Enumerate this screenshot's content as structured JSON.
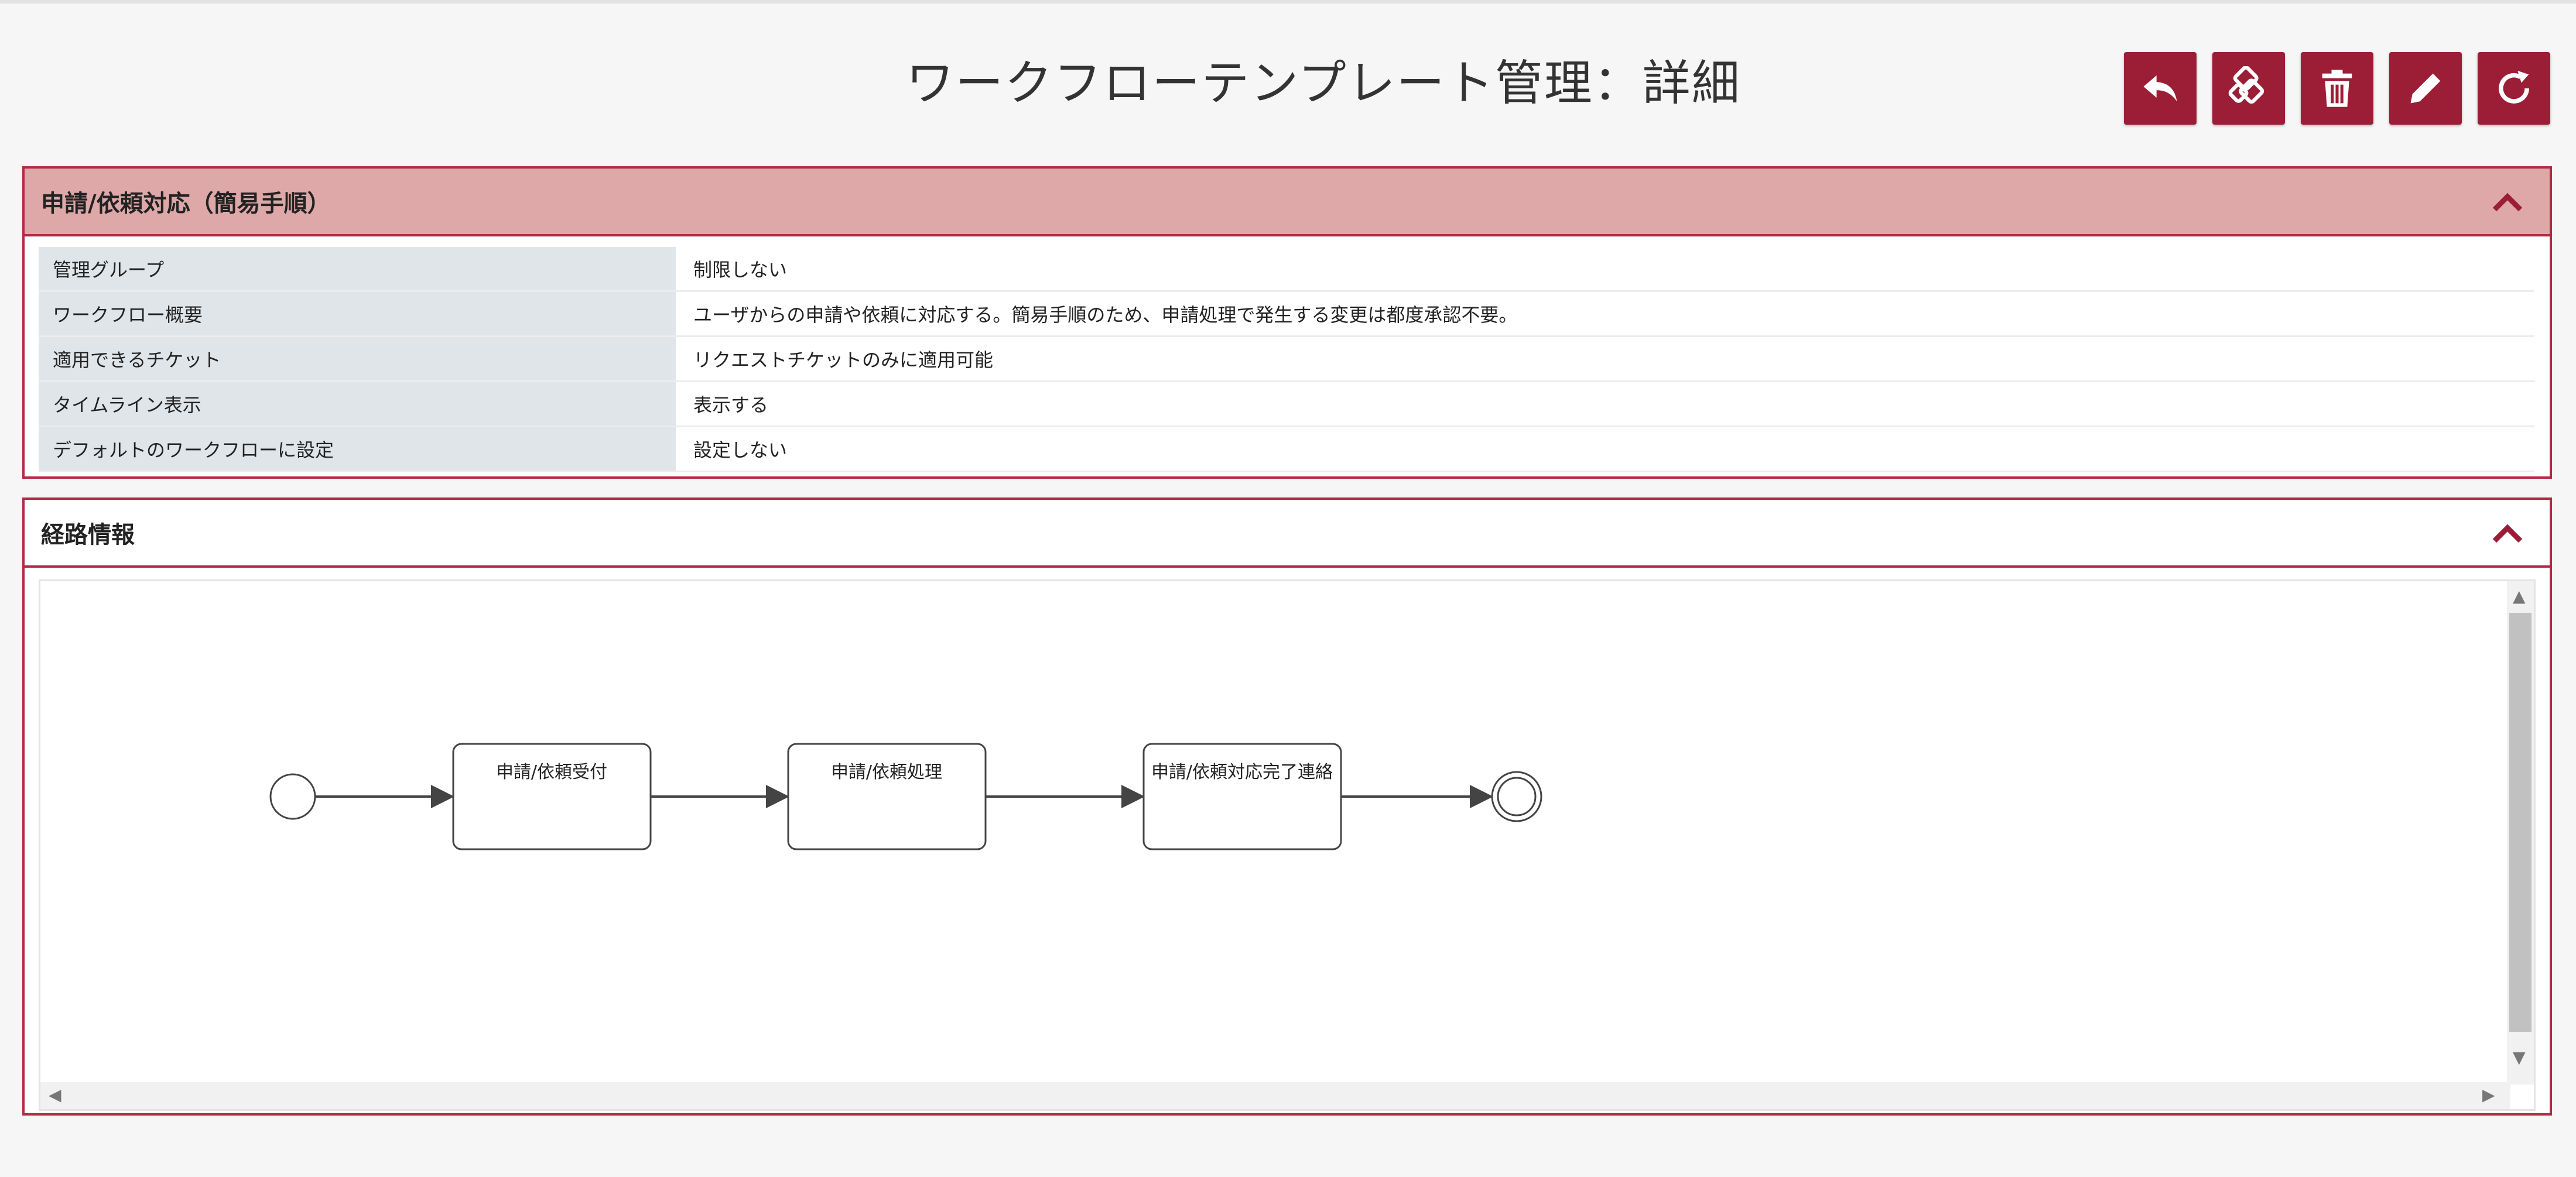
{
  "header": {
    "title": "ワークフローテンプレート管理：詳細",
    "buttons": [
      {
        "name": "back-button",
        "icon": "reply-icon"
      },
      {
        "name": "copy-button",
        "icon": "duplicate-icon"
      },
      {
        "name": "delete-button",
        "icon": "trash-icon"
      },
      {
        "name": "edit-button",
        "icon": "pencil-icon"
      },
      {
        "name": "refresh-button",
        "icon": "refresh-icon"
      }
    ]
  },
  "panel1": {
    "title": "申請/依頼対応（簡易手順）",
    "rows": [
      {
        "label": "管理グループ",
        "value": "制限しない"
      },
      {
        "label": "ワークフロー概要",
        "value": "ユーザからの申請や依頼に対応する。簡易手順のため、申請処理で発生する変更は都度承認不要。"
      },
      {
        "label": "適用できるチケット",
        "value": "リクエストチケットのみに適用可能"
      },
      {
        "label": "タイムライン表示",
        "value": "表示する"
      },
      {
        "label": "デフォルトのワークフローに設定",
        "value": "設定しない"
      }
    ]
  },
  "panel2": {
    "title": "経路情報",
    "nodes": [
      {
        "label": "申請/依頼受付"
      },
      {
        "label": "申請/依頼処理"
      },
      {
        "label": "申請/依頼対応完了連絡"
      }
    ]
  },
  "colors": {
    "accent": "#9b1e36",
    "panel_border": "#b32a45",
    "panel_header_bg": "#dea8a8",
    "label_cell_bg": "#e0e5e9"
  }
}
